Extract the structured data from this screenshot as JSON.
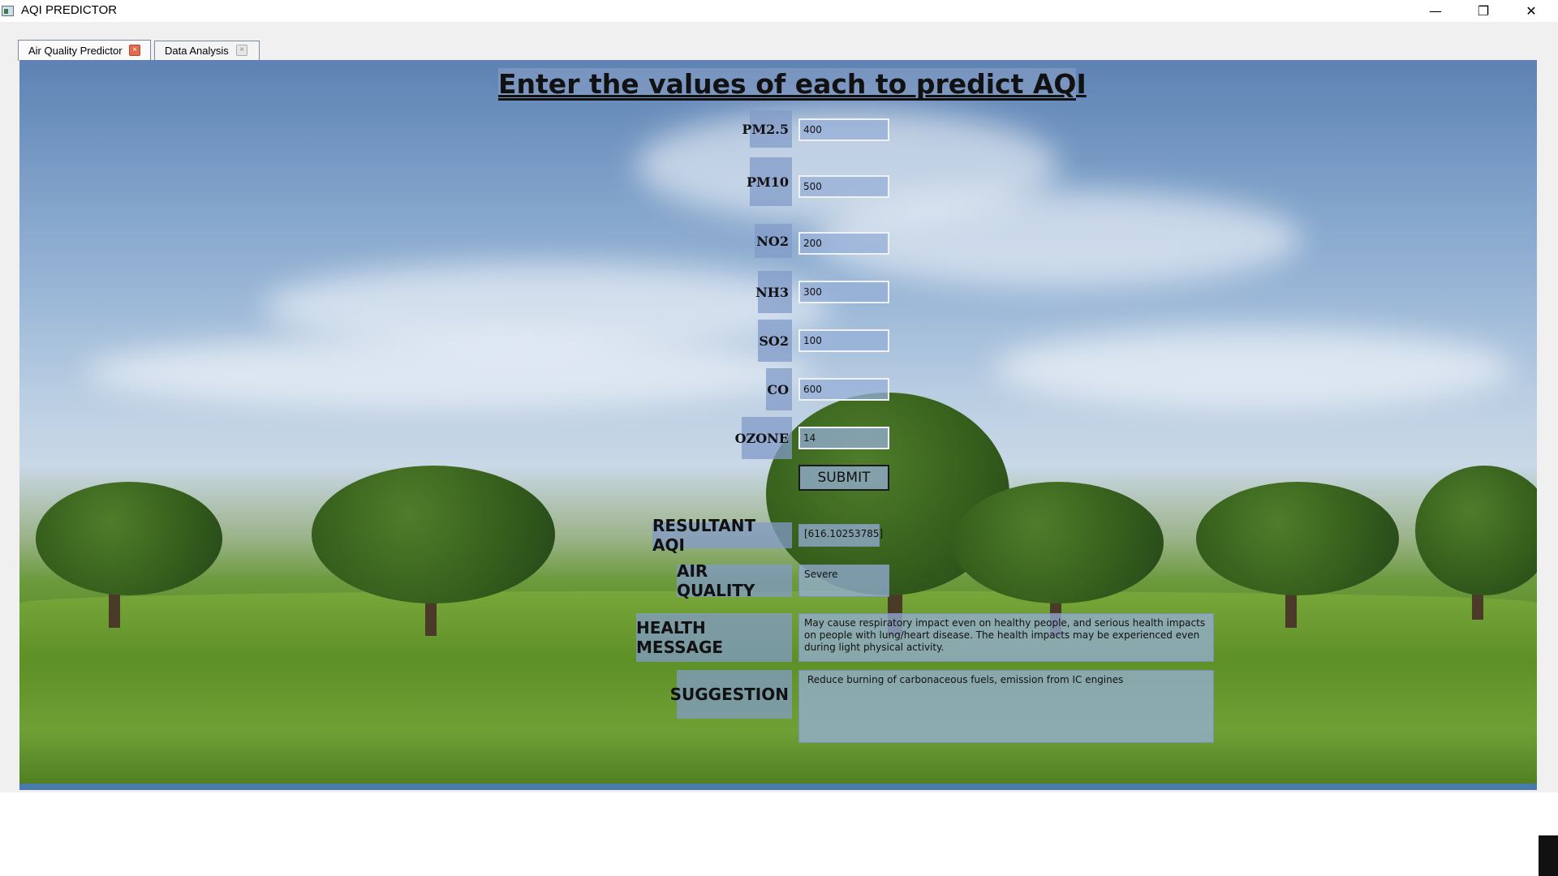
{
  "window": {
    "title": "AQI PREDICTOR",
    "minimize": "—",
    "maximize": "❐",
    "close": "✕"
  },
  "tabs": [
    {
      "label": "Air Quality Predictor",
      "close": "×"
    },
    {
      "label": "Data Analysis",
      "close": "×"
    }
  ],
  "form": {
    "heading": "Enter the values of each to predict AQI",
    "fields": [
      {
        "label": "PM2.5",
        "value": "400"
      },
      {
        "label": "PM10",
        "value": "500"
      },
      {
        "label": "NO2",
        "value": "200"
      },
      {
        "label": "NH3",
        "value": "300"
      },
      {
        "label": "SO2",
        "value": "100"
      },
      {
        "label": "CO",
        "value": "600"
      },
      {
        "label": "OZONE",
        "value": "14"
      }
    ],
    "submit_label": "SUBMIT"
  },
  "results": {
    "aqi_label": "RESULTANT AQI",
    "aqi_value": "[616.10253785]",
    "quality_label": "AIR QUALITY",
    "quality_value": "Severe",
    "health_label": "HEALTH MESSAGE",
    "health_value": "May cause respiratory impact even on healthy people, and serious health impacts on people with lung/heart disease. The health impacts may be experienced even during light physical activity.",
    "suggestion_label": "SUGGESTION",
    "suggestion_value": "Reduce burning of carbonaceous fuels, emission from IC engines"
  }
}
